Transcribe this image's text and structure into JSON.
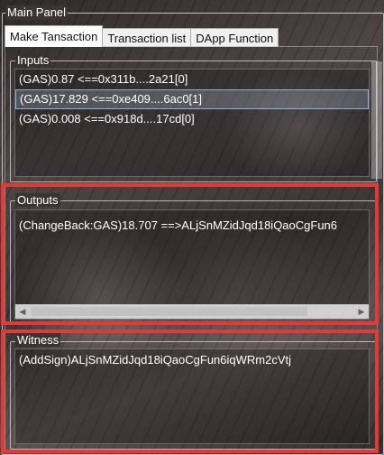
{
  "main_panel": {
    "title": "Main Panel"
  },
  "tabs": [
    {
      "label": "Make Tansaction",
      "active": true
    },
    {
      "label": "Transaction list",
      "active": false
    },
    {
      "label": "DApp Function",
      "active": false
    }
  ],
  "inputs": {
    "title": "Inputs",
    "items": [
      {
        "text": "(GAS)0.87 <==0x311b....2a21[0]",
        "selected": false
      },
      {
        "text": "(GAS)17.829 <==0xe409....6ac0[1]",
        "selected": true
      },
      {
        "text": "(GAS)0.008 <==0x918d....17cd[0]",
        "selected": false
      }
    ]
  },
  "outputs": {
    "title": "Outputs",
    "items": [
      {
        "text": "(ChangeBack:GAS)18.707 ==>ALjSnMZidJqd18iQaoCgFun6"
      }
    ]
  },
  "witness": {
    "title": "Witness",
    "items": [
      {
        "text": "(AddSign)ALjSnMZidJqd18iQaoCgFun6iqWRm2cVtj"
      }
    ]
  },
  "colors": {
    "highlight": "#e53935",
    "selection": "#99d1ff"
  }
}
